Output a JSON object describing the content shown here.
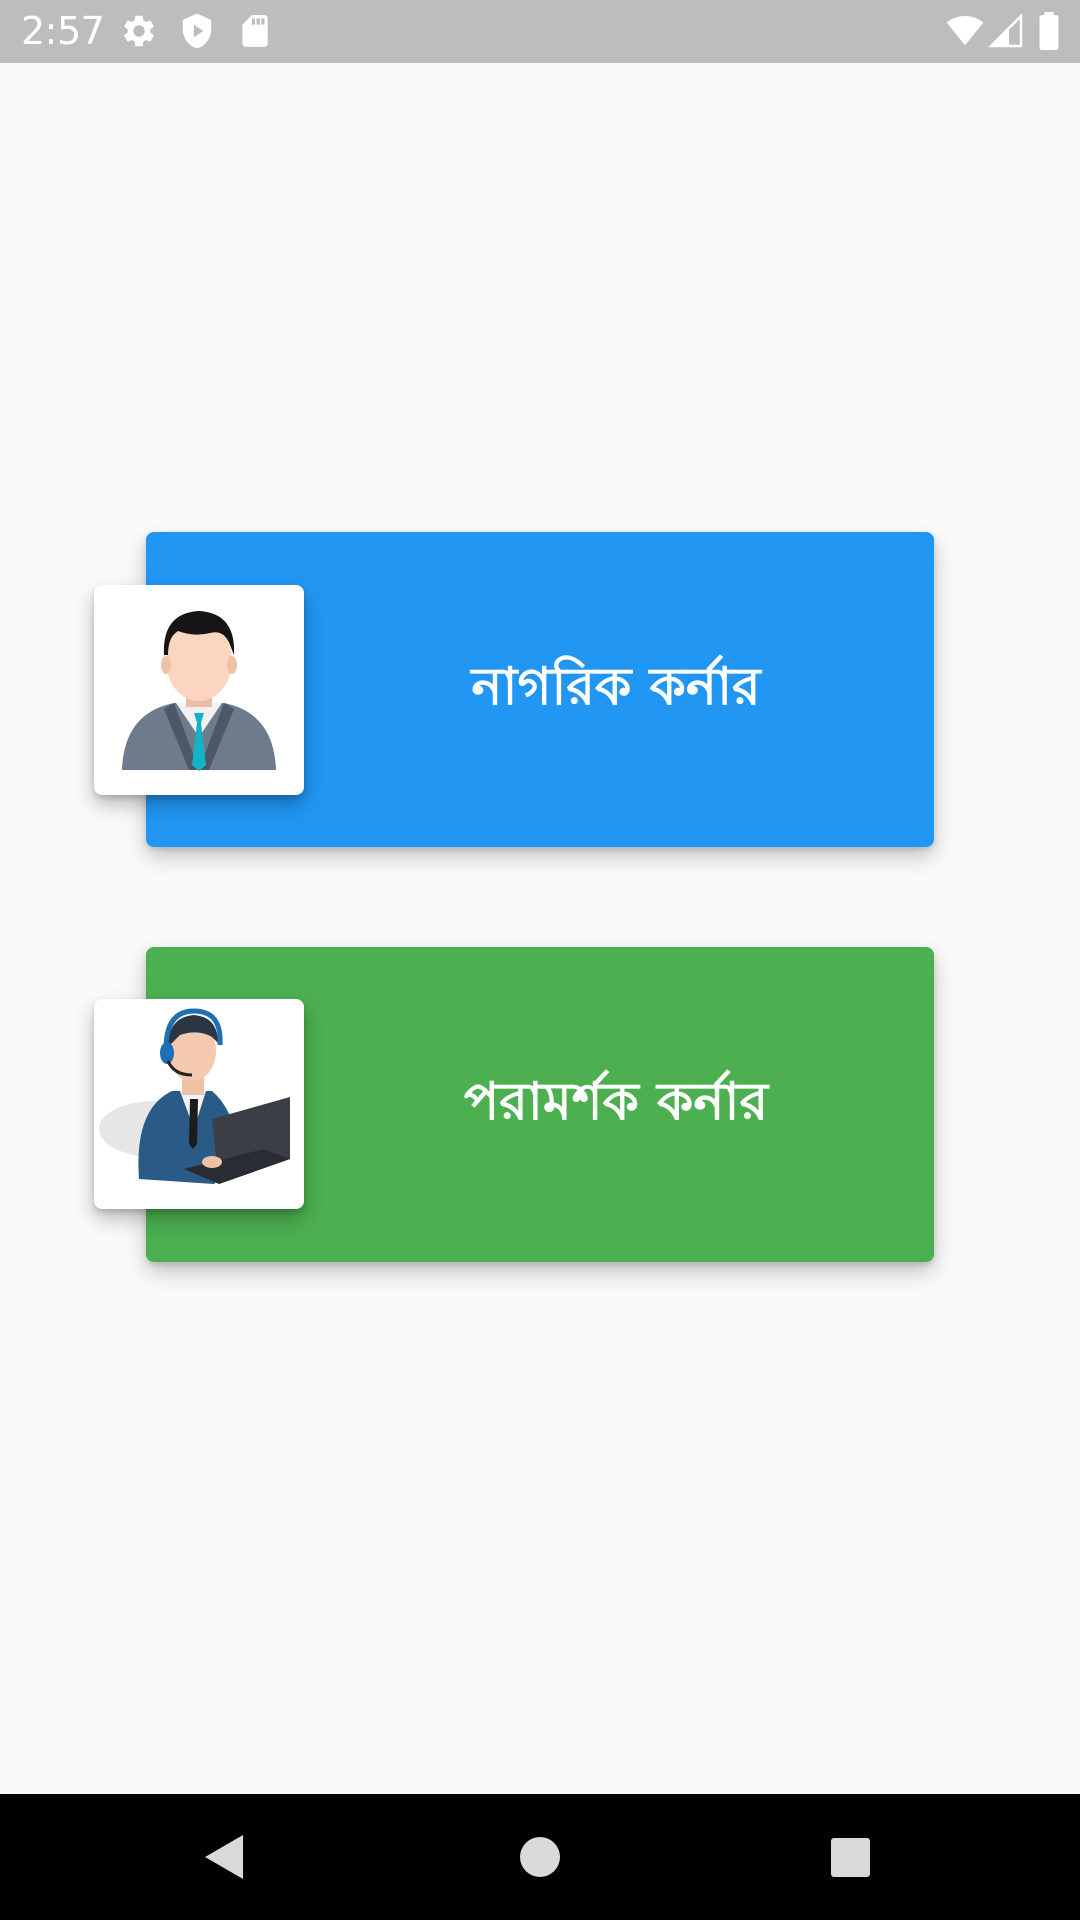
{
  "status_bar": {
    "time": "2:57",
    "left_icons": [
      "gear-icon",
      "shield-play-icon",
      "sd-card-icon"
    ],
    "right_icons": [
      "wifi-icon",
      "cell-signal-icon",
      "battery-icon"
    ]
  },
  "cards": [
    {
      "label": "নাগরিক কর্নার",
      "color": "#2196f3",
      "image": "citizen-avatar"
    },
    {
      "label": "পরামর্শক কর্নার",
      "color": "#4caf50",
      "image": "counselor-avatar"
    }
  ],
  "nav_bar": {
    "buttons": [
      "back-icon",
      "home-icon",
      "recents-icon"
    ]
  }
}
